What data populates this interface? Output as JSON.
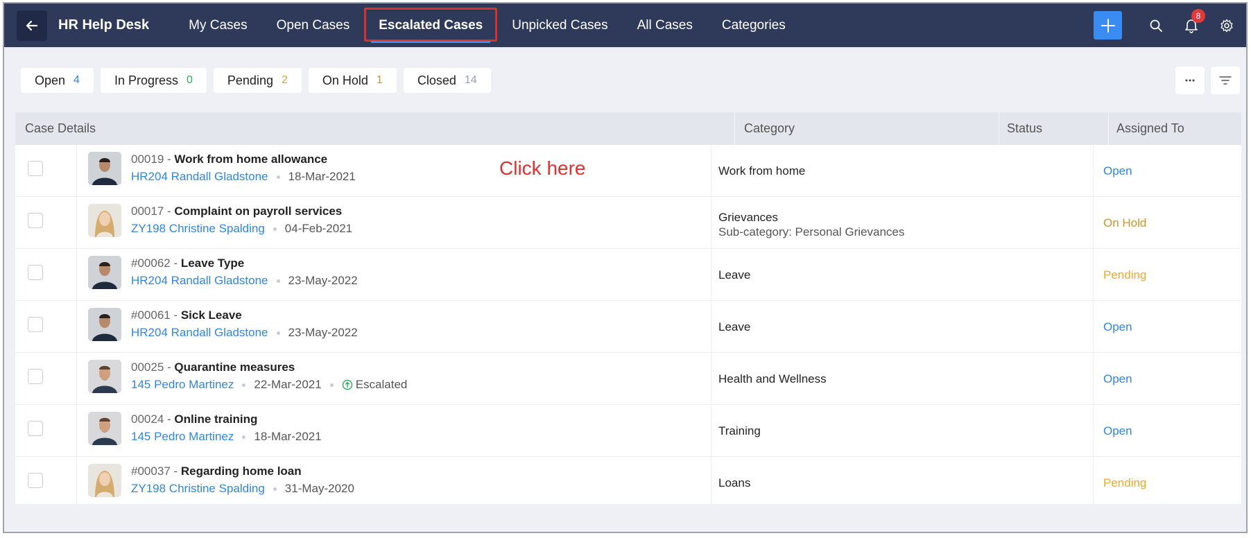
{
  "nav": {
    "app_title": "HR Help Desk",
    "tabs": [
      {
        "label": "My Cases"
      },
      {
        "label": "Open Cases"
      },
      {
        "label": "Escalated Cases"
      },
      {
        "label": "Unpicked Cases"
      },
      {
        "label": "All Cases"
      },
      {
        "label": "Categories"
      }
    ],
    "active_tab": "Escalated Cases",
    "notification_count": "8",
    "icons": [
      "back-arrow-icon",
      "plus-icon",
      "search-icon",
      "bell-icon",
      "gear-icon"
    ]
  },
  "status_pills": [
    {
      "label": "Open",
      "count": "4",
      "color": "#2f86dc"
    },
    {
      "label": "In Progress",
      "count": "0",
      "color": "#2ea861"
    },
    {
      "label": "Pending",
      "count": "2",
      "color": "#e0a32b"
    },
    {
      "label": "On Hold",
      "count": "1",
      "color": "#c9962c"
    },
    {
      "label": "Closed",
      "count": "14",
      "color": "#9aa0a8"
    }
  ],
  "table": {
    "headers": {
      "case_details": "Case Details",
      "category": "Category",
      "status": "Status",
      "assigned_to": "Assigned To"
    },
    "rows": [
      {
        "id": "00019",
        "subject": "Work from home allowance",
        "employee": "HR204 Randall Gladstone",
        "date": "18-Mar-2021",
        "escalated": "",
        "category": "Work from home",
        "subcategory": "",
        "status": "Open",
        "status_color": "#2f86dc",
        "avatar": "man-dark"
      },
      {
        "id": "00017",
        "subject": "Complaint on payroll services",
        "employee": "ZY198 Christine Spalding",
        "date": "04-Feb-2021",
        "escalated": "",
        "category": "Grievances",
        "subcategory": "Sub-category: Personal Grievances",
        "status": "On Hold",
        "status_color": "#c9962c",
        "avatar": "woman-blonde"
      },
      {
        "id": "#00062",
        "subject": "Leave Type",
        "employee": "HR204 Randall Gladstone",
        "date": "23-May-2022",
        "escalated": "",
        "category": "Leave",
        "subcategory": "",
        "status": "Pending",
        "status_color": "#e9a92e",
        "avatar": "man-dark"
      },
      {
        "id": "#00061",
        "subject": "Sick Leave",
        "employee": "HR204 Randall Gladstone",
        "date": "23-May-2022",
        "escalated": "",
        "category": "Leave",
        "subcategory": "",
        "status": "Open",
        "status_color": "#2f86dc",
        "avatar": "man-dark"
      },
      {
        "id": "00025",
        "subject": "Quarantine measures",
        "employee": "145 Pedro Martinez",
        "date": "22-Mar-2021",
        "escalated": "Escalated",
        "category": "Health and Wellness",
        "subcategory": "",
        "status": "Open",
        "status_color": "#2f86dc",
        "avatar": "man-beard"
      },
      {
        "id": "00024",
        "subject": "Online training",
        "employee": "145 Pedro Martinez",
        "date": "18-Mar-2021",
        "escalated": "",
        "category": "Training",
        "subcategory": "",
        "status": "Open",
        "status_color": "#2f86dc",
        "avatar": "man-beard"
      },
      {
        "id": "#00037",
        "subject": "Regarding home loan",
        "employee": "ZY198 Christine Spalding",
        "date": "31-May-2020",
        "escalated": "",
        "category": "Loans",
        "subcategory": "",
        "status": "Pending",
        "status_color": "#e9a92e",
        "avatar": "woman-blonde"
      }
    ]
  },
  "annotation": {
    "text": "Click here",
    "color": "#d9322f"
  }
}
